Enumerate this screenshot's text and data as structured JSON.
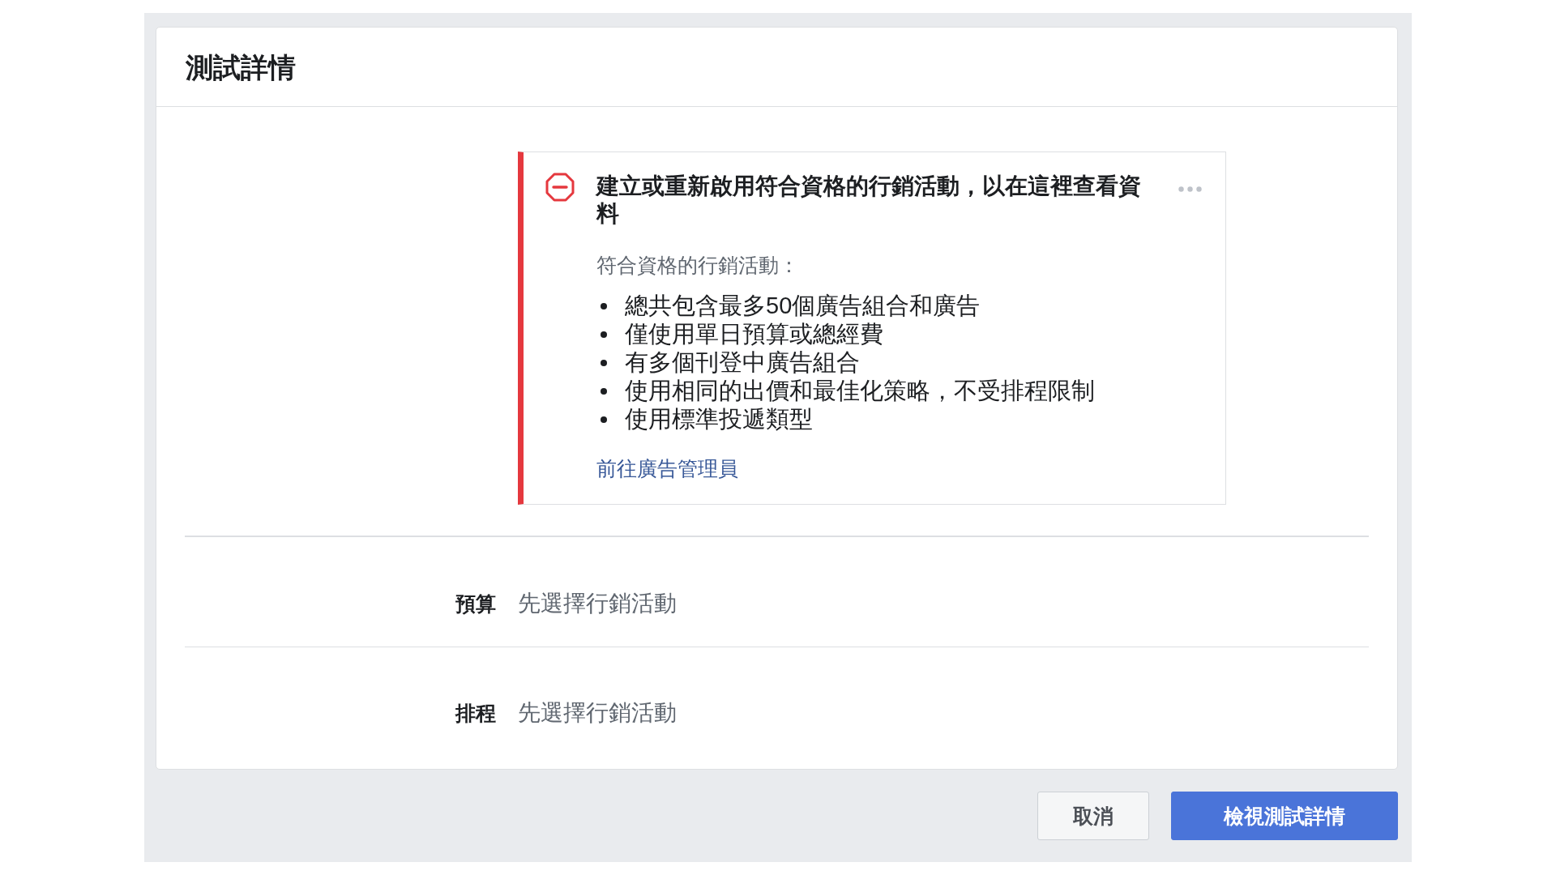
{
  "dialog": {
    "title": "測試詳情"
  },
  "alert": {
    "kind": "error",
    "title": "建立或重新啟用符合資格的行銷活動，以在這裡查看資料",
    "subtitle": "符合資格的行銷活動：",
    "items": [
      "總共包含最多50個廣告組合和廣告",
      "僅使用單日預算或總經費",
      "有多個刊登中廣告組合",
      "使用相同的出價和最佳化策略，不受排程限制",
      "使用標準投遞類型"
    ],
    "link": "前往廣告管理員"
  },
  "fields": [
    {
      "label": "預算",
      "value": "先選擇行銷活動"
    },
    {
      "label": "排程",
      "value": "先選擇行銷活動"
    }
  ],
  "buttons": [
    {
      "label": "取消",
      "kind": "secondary"
    },
    {
      "label": "檢視測試詳情",
      "kind": "primary"
    }
  ]
}
